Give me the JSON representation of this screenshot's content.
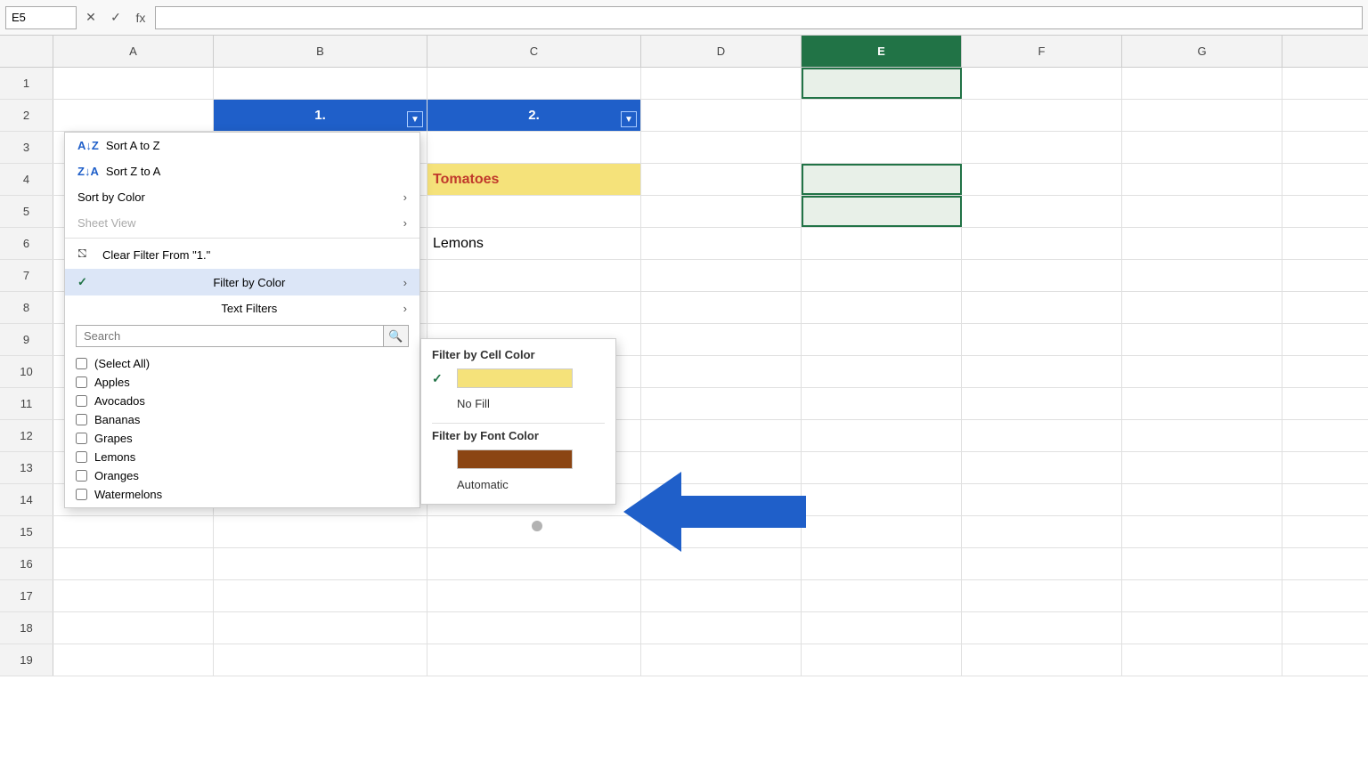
{
  "formula_bar": {
    "cell_ref": "E5",
    "cancel_label": "✕",
    "confirm_label": "✓",
    "fx_label": "fx",
    "formula_value": ""
  },
  "columns": [
    "A",
    "B",
    "C",
    "D",
    "E",
    "F",
    "G"
  ],
  "rows": [
    1,
    2,
    3,
    4,
    5,
    6,
    7,
    8,
    9,
    10,
    11,
    12,
    13,
    14,
    15,
    16,
    17,
    18,
    19
  ],
  "cells": {
    "B2": {
      "value": "1.",
      "type": "blue-header"
    },
    "C2": {
      "value": "2.",
      "type": "blue-header"
    },
    "C4": {
      "value": "Tomatoes",
      "type": "tomatoes"
    },
    "C6": {
      "value": "Lemons",
      "type": "lemons"
    }
  },
  "dropdown": {
    "items": [
      {
        "id": "sort-az",
        "icon": "AZ↓",
        "label": "Sort A to Z",
        "has_arrow": false,
        "disabled": false,
        "active": false
      },
      {
        "id": "sort-za",
        "icon": "ZA↓",
        "label": "Sort Z to A",
        "has_arrow": false,
        "disabled": false,
        "active": false
      },
      {
        "id": "sort-color",
        "icon": "",
        "label": "Sort by Color",
        "has_arrow": true,
        "disabled": false,
        "active": false
      },
      {
        "id": "sheet-view",
        "icon": "",
        "label": "Sheet View",
        "has_arrow": true,
        "disabled": true,
        "active": false
      },
      {
        "id": "clear-filter",
        "icon": "⛞",
        "label": "Clear Filter From \"1.\"",
        "has_arrow": false,
        "disabled": false,
        "active": false
      },
      {
        "id": "filter-color",
        "icon": "",
        "label": "Filter by Color",
        "has_arrow": true,
        "disabled": false,
        "active": true
      },
      {
        "id": "text-filters",
        "icon": "",
        "label": "Text Filters",
        "has_arrow": true,
        "disabled": false,
        "active": false
      }
    ],
    "search_placeholder": "Search",
    "checklist": [
      {
        "label": "(Select All)",
        "checked": false
      },
      {
        "label": "Apples",
        "checked": false
      },
      {
        "label": "Avocados",
        "checked": false
      },
      {
        "label": "Bananas",
        "checked": false
      },
      {
        "label": "Grapes",
        "checked": false
      },
      {
        "label": "Lemons",
        "checked": false
      },
      {
        "label": "Oranges",
        "checked": false
      },
      {
        "label": "Watermelons",
        "checked": false
      }
    ]
  },
  "color_submenu": {
    "cell_color_title": "Filter by Cell Color",
    "swatch_color": "#f5e27a",
    "no_fill_label": "No Fill",
    "font_color_title": "Filter by Font Color",
    "font_swatch_color": "#8B4513",
    "automatic_label": "Automatic"
  }
}
